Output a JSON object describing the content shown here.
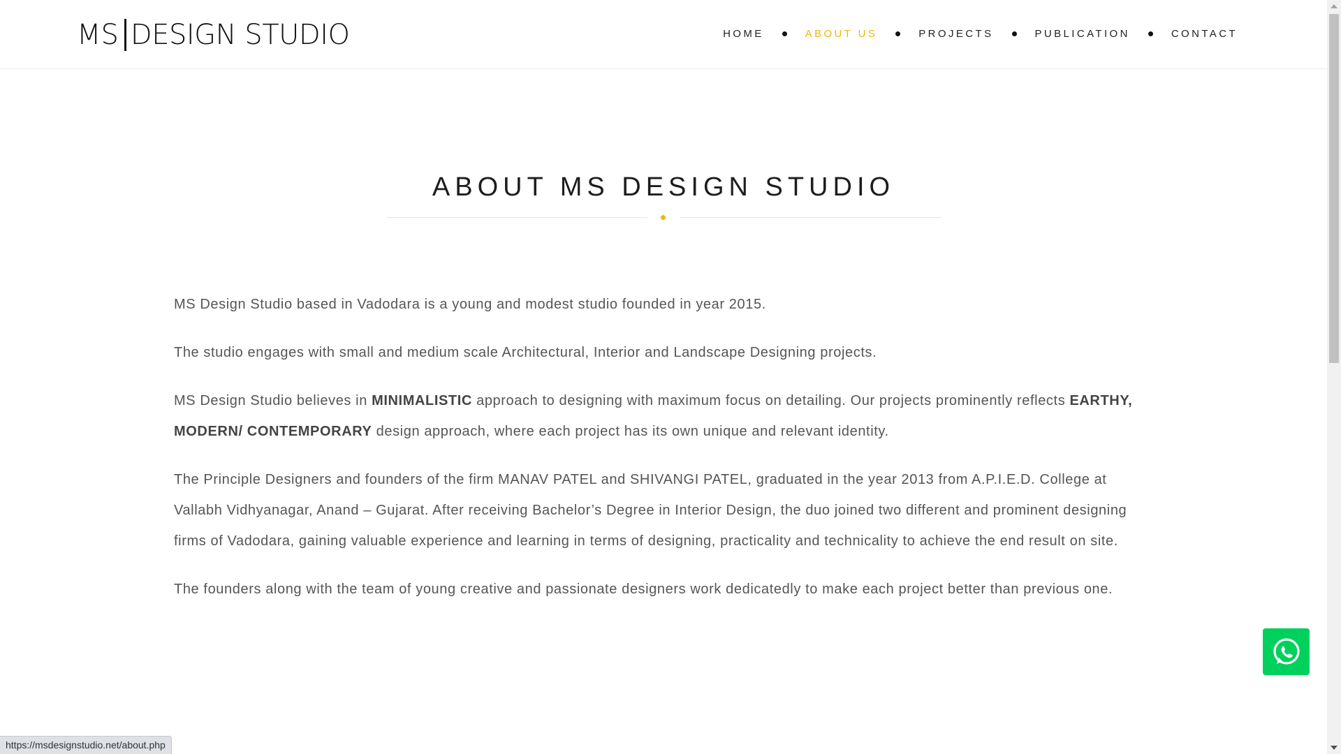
{
  "logo": {
    "left": "MS",
    "right": "DESIGN STUDIO"
  },
  "nav": {
    "items": [
      {
        "label": "HOME",
        "active": false
      },
      {
        "label": "ABOUT US",
        "active": true
      },
      {
        "label": "PROJECTS",
        "active": false
      },
      {
        "label": "PUBLICATION",
        "active": false
      },
      {
        "label": "CONTACT",
        "active": false
      }
    ]
  },
  "page": {
    "title": "ABOUT MS DESIGN STUDIO"
  },
  "content": {
    "p1": "MS Design Studio based in Vadodara is a young and modest studio founded in year 2015.",
    "p2": "The studio engages with small and medium scale Architectural, Interior and Landscape Designing projects.",
    "p3_a": "MS Design Studio believes in ",
    "p3_b": "MINIMALISTIC",
    "p3_c": " approach to designing with maximum focus on detailing. Our projects prominently reflects ",
    "p3_d": "EARTHY, MODERN/ CONTEMPORARY",
    "p3_e": " design approach, where each project has its own unique and relevant identity.",
    "p4": "The Principle Designers and founders of the firm MANAV PATEL and SHIVANGI PATEL, graduated in the year 2013 from A.P.I.E.D. College at Vallabh Vidhyanagar, Anand – Gujarat. After receiving Bachelor’s Degree in Interior Design, the duo joined two different and prominent designing firms of Vadodara, gaining valuable experience and learning in terms of designing, practicality and technicality to achieve the end result on site.",
    "p5": "The founders along with the team of young creative and passionate designers work dedicatedly to make each project better than previous one."
  },
  "widgets": {
    "whatsapp_icon": "whatsapp-icon"
  },
  "statusbar": {
    "url": "https://msdesignstudio.net/about.php"
  },
  "colors": {
    "accent": "#f2b705",
    "whatsapp": "#00d15d",
    "text": "#555555",
    "heading": "#1d1d1d"
  }
}
